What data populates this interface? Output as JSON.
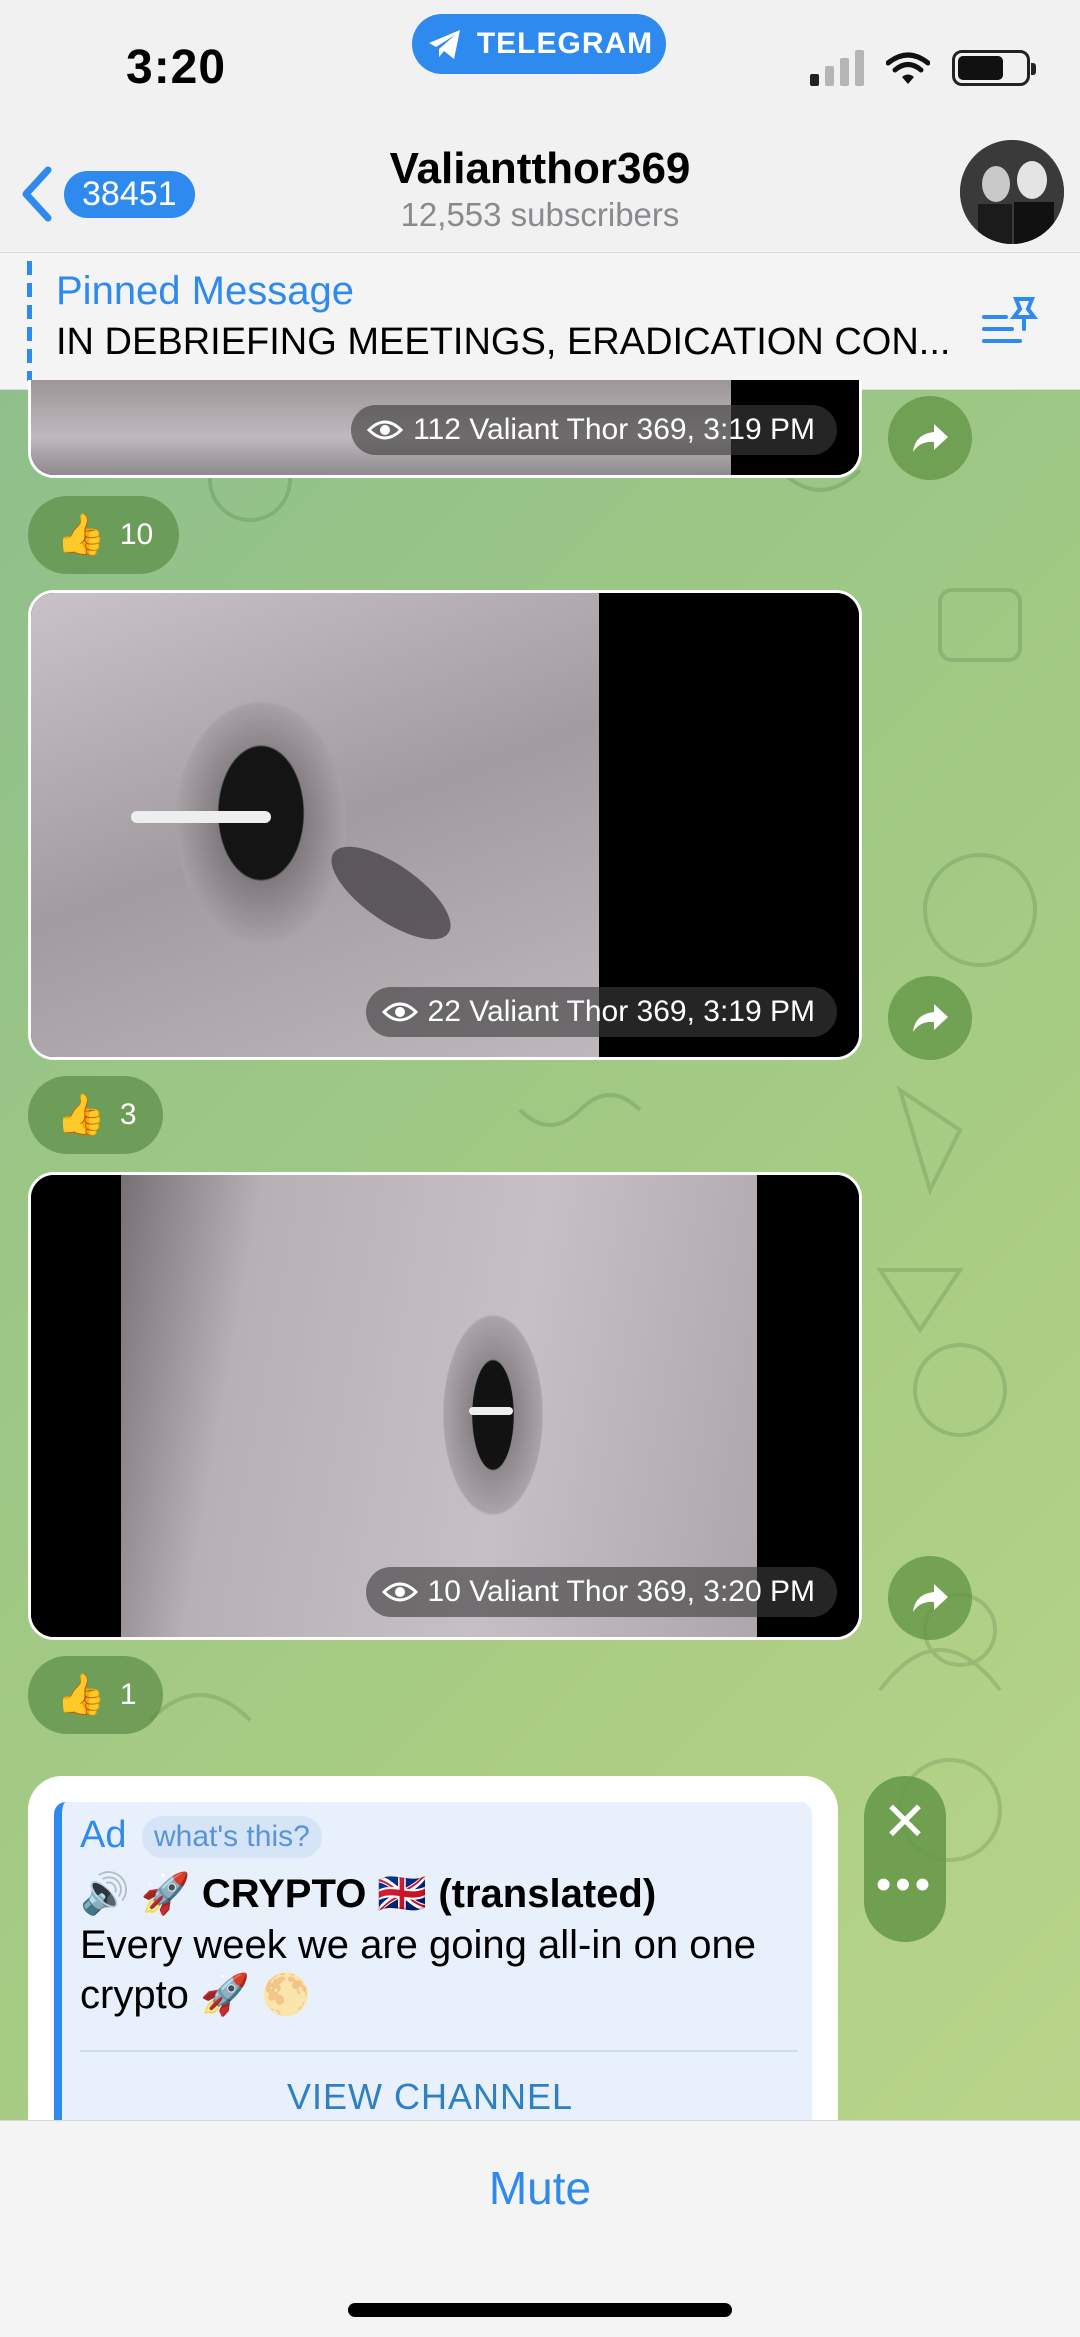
{
  "status_bar": {
    "time": "3:20",
    "app_pill": "TELEGRAM"
  },
  "header": {
    "back_count": "38451",
    "title": "Valiantthor369",
    "subtitle": "12,553 subscribers"
  },
  "pinned": {
    "label": "Pinned Message",
    "text": "IN DEBRIEFING MEETINGS, ERADICATION CON..."
  },
  "messages": [
    {
      "meta": "112 Valiant Thor 369, 3:19 PM",
      "reaction_count": "10"
    },
    {
      "meta": "22 Valiant Thor 369, 3:19 PM",
      "reaction_count": "3"
    },
    {
      "meta": "10 Valiant Thor 369, 3:20 PM",
      "reaction_count": "1"
    }
  ],
  "ad": {
    "tag": "Ad",
    "whats_this": "what's this?",
    "title": "🔊 🚀 CRYPTO 🇬🇧 (translated)",
    "body": "Every week we are going all-in on one crypto 🚀 🌕",
    "button": "VIEW CHANNEL",
    "close_glyph": "✕",
    "more_glyph": "•••"
  },
  "bottom": {
    "mute_label": "Mute"
  },
  "colors": {
    "accent": "#2f8af0",
    "wallpaper_start": "#8fc08c",
    "wallpaper_end": "#b9d58a"
  }
}
